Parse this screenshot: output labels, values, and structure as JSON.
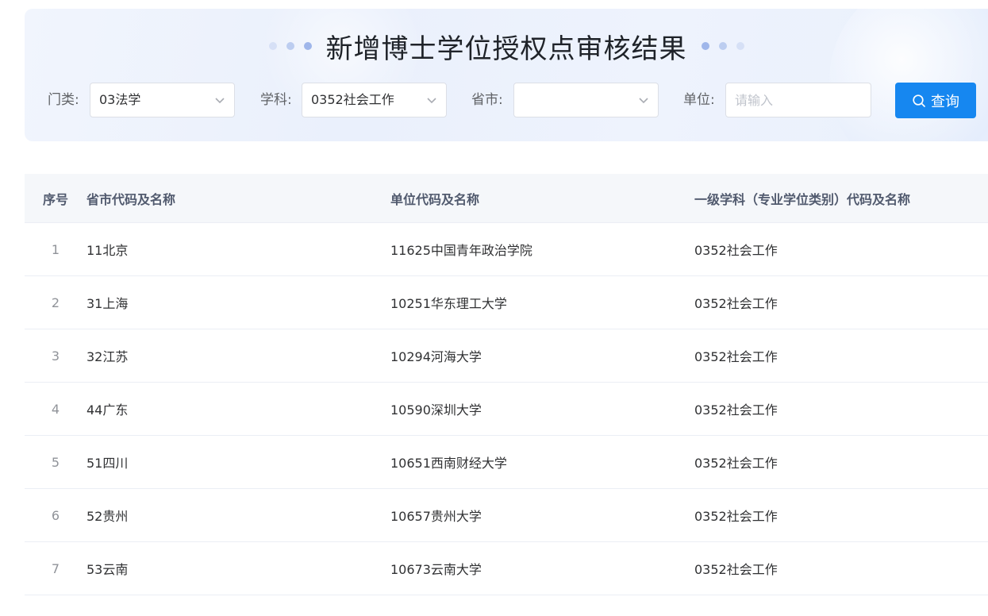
{
  "page": {
    "title": "新增博士学位授权点审核结果"
  },
  "filters": {
    "category_label": "门类:",
    "category_value": "03法学",
    "discipline_label": "学科:",
    "discipline_value": "0352社会工作",
    "province_label": "省市:",
    "province_value": "",
    "unit_label": "单位:",
    "unit_value": "",
    "unit_placeholder": "请输入",
    "search_button": "查询"
  },
  "icons": {
    "select_arrow": "chevron-down-icon",
    "search": "search-icon"
  },
  "colors": {
    "primary": "#1687f0",
    "header_bg": "#f5f7fa",
    "hero_bg": "#eaf0fc"
  },
  "table": {
    "headers": [
      "序号",
      "省市代码及名称",
      "单位代码及名称",
      "一级学科（专业学位类别）代码及名称"
    ],
    "rows": [
      [
        "1",
        "11北京",
        "11625中国青年政治学院",
        "0352社会工作"
      ],
      [
        "2",
        "31上海",
        "10251华东理工大学",
        "0352社会工作"
      ],
      [
        "3",
        "32江苏",
        "10294河海大学",
        "0352社会工作"
      ],
      [
        "4",
        "44广东",
        "10590深圳大学",
        "0352社会工作"
      ],
      [
        "5",
        "51四川",
        "10651西南财经大学",
        "0352社会工作"
      ],
      [
        "6",
        "52贵州",
        "10657贵州大学",
        "0352社会工作"
      ],
      [
        "7",
        "53云南",
        "10673云南大学",
        "0352社会工作"
      ]
    ]
  }
}
